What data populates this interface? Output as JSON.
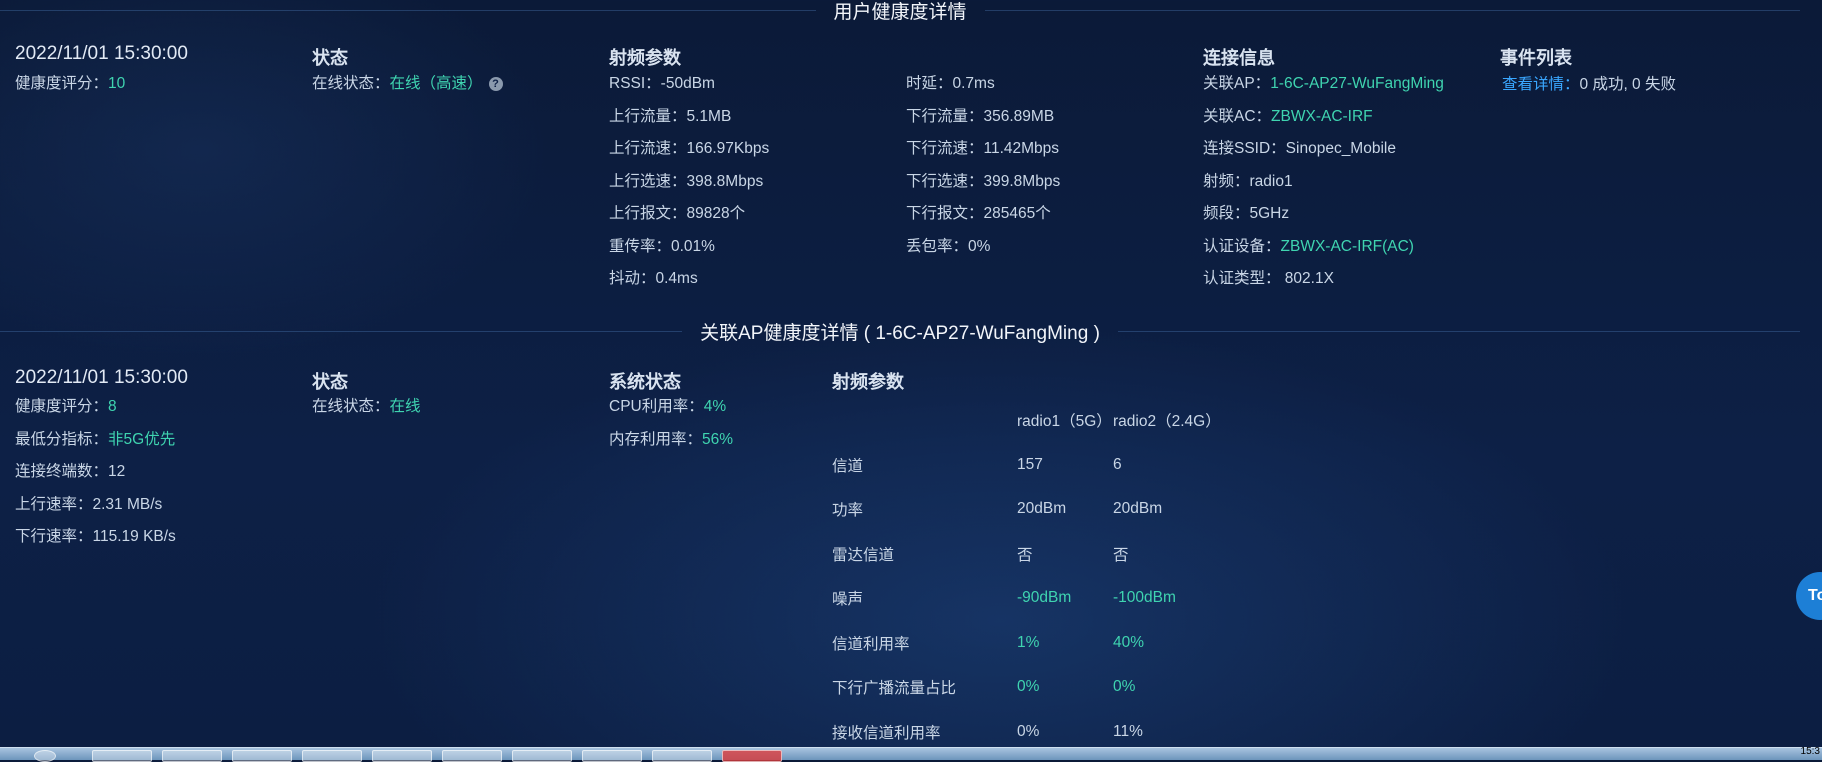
{
  "user_section": {
    "title": "用户健康度详情",
    "date": "2022/11/01 15:30:00",
    "health_label": "健康度评分：",
    "health_value": "10",
    "status": {
      "heading": "状态",
      "online_label": "在线状态：",
      "online_value": "在线（高速）"
    },
    "radio": {
      "heading": "射频参数",
      "left": [
        "RSSI：-50dBm",
        "上行流量：5.1MB",
        "上行流速：166.97Kbps",
        "上行选速：398.8Mbps",
        "上行报文：89828个",
        "重传率：0.01%",
        "抖动：0.4ms"
      ],
      "right": [
        "时延：0.7ms",
        "下行流量：356.89MB",
        "下行流速：11.42Mbps",
        "下行选速：399.8Mbps",
        "下行报文：285465个",
        "丢包率：0%"
      ]
    },
    "connection": {
      "heading": "连接信息",
      "ap_label": "关联AP：",
      "ap_value": "1-6C-AP27-WuFangMing",
      "ac_label": "关联AC：",
      "ac_value": "ZBWX-AC-IRF",
      "ssid": "连接SSID：Sinopec_Mobile",
      "radio": "射频：radio1",
      "band": "频段：5GHz",
      "auth_dev_label": "认证设备：",
      "auth_dev_value": "ZBWX-AC-IRF(AC)",
      "auth_type": "认证类型： 802.1X"
    },
    "events": {
      "heading": "事件列表",
      "link": "查看详情：",
      "summary": "0 成功, 0 失败"
    }
  },
  "ap_section": {
    "title": "关联AP健康度详情 ( 1-6C-AP27-WuFangMing )",
    "date": "2022/11/01 15:30:00",
    "health_label": "健康度评分：",
    "health_value": "8",
    "lowest_label": "最低分指标：",
    "lowest_value": "非5G优先",
    "clients": "连接终端数：12",
    "up_rate": "上行速率：2.31 MB/s",
    "down_rate": "下行速率：115.19 KB/s",
    "status": {
      "heading": "状态",
      "online_label": "在线状态：",
      "online_value": "在线"
    },
    "system": {
      "heading": "系统状态",
      "cpu_label": "CPU利用率：",
      "cpu_value": "4%",
      "mem_label": "内存利用率：",
      "mem_value": "56%"
    },
    "radio_table": {
      "heading": "射频参数",
      "col1": "radio1（5G）",
      "col2": "radio2（2.4G）",
      "rows": [
        {
          "label": "信道",
          "v1": "157",
          "v2": "6",
          "green": false
        },
        {
          "label": "功率",
          "v1": "20dBm",
          "v2": "20dBm",
          "green": false
        },
        {
          "label": "雷达信道",
          "v1": "否",
          "v2": "否",
          "green": false
        },
        {
          "label": "噪声",
          "v1": "-90dBm",
          "v2": "-100dBm",
          "green": true
        },
        {
          "label": "信道利用率",
          "v1": "1%",
          "v2": "40%",
          "green": true
        },
        {
          "label": "下行广播流量占比",
          "v1": "0%",
          "v2": "0%",
          "green": true
        },
        {
          "label": "接收信道利用率",
          "v1": "0%",
          "v2": "11%",
          "green": false
        }
      ]
    }
  },
  "top_button": "To",
  "clock": "15:3"
}
